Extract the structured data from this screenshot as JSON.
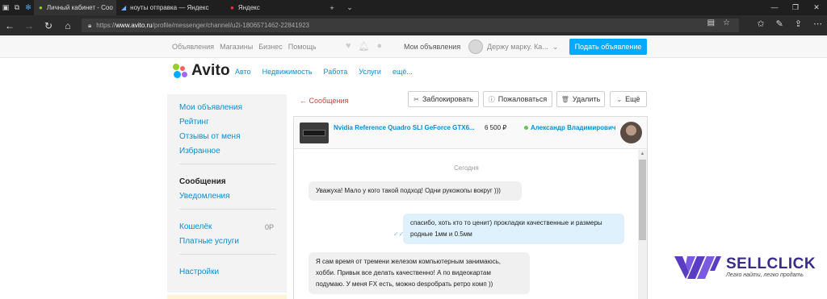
{
  "browser": {
    "tabs": [
      {
        "title": "Личный кабинет - Coo",
        "active": true
      },
      {
        "title": "ноуты отправка — Яндекс",
        "active": false
      },
      {
        "title": "Яндекс",
        "active": false
      }
    ],
    "url_prefix": "https://",
    "url_host": "www.avito.ru",
    "url_path": "/profile/messenger/channel/u2i-1806571462-22841923"
  },
  "topnav": {
    "links": [
      "Объявления",
      "Магазины",
      "Бизнес",
      "Помощь"
    ],
    "my_ads": "Мои объявления",
    "user_name": "Держу марку. Ка...",
    "post_button": "Подать объявление"
  },
  "logo": {
    "text": "Avito",
    "colors": [
      "#97cf26",
      "#ff6163",
      "#0af",
      "#a169f7"
    ]
  },
  "categories": [
    "Авто",
    "Недвижимость",
    "Работа",
    "Услуги",
    "ещё..."
  ],
  "sidebar": {
    "my_ads": "Мои объявления",
    "rating": "Рейтинг",
    "reviews": "Отзывы от меня",
    "favorites": "Избранное",
    "messages": "Сообщения",
    "notifications": "Уведомления",
    "wallet": "Кошелёк",
    "wallet_value": "0Р",
    "paid_services": "Платные услуги",
    "settings": "Настройки"
  },
  "actions": {
    "back": "← Сообщения",
    "block": "Заблокировать",
    "report": "Пожаловаться",
    "delete": "Удалить",
    "more": "Ещё"
  },
  "chat": {
    "product_title": "Nvidia Reference Quadro SLI GeForce GTX6...",
    "price": "6 500 ₽",
    "seller": "Александр Владимирович",
    "date_label": "Сегодня",
    "messages": [
      {
        "dir": "in",
        "text": "Уважуха! Мало у кого такой подход! Одни рукожопы вокруг )))"
      },
      {
        "dir": "out",
        "line1": "спасибо, хоть кто то ценит) прокладки качественные и размеры",
        "line2": "родные 1мм и 0.5мм"
      },
      {
        "dir": "in",
        "line1": "Я сам время от тремени железом компьютерным занимаюсь,",
        "line2": "хобби. Привык все делать качественно! А по видеокартам",
        "line3": "подумаю. У меня FX есть, можно despобрать ретро комп ))"
      }
    ]
  },
  "watermark": {
    "brand": "SELLCLICK",
    "tagline": "Легко найти, легко продать",
    "color": "#3a2a8c"
  }
}
